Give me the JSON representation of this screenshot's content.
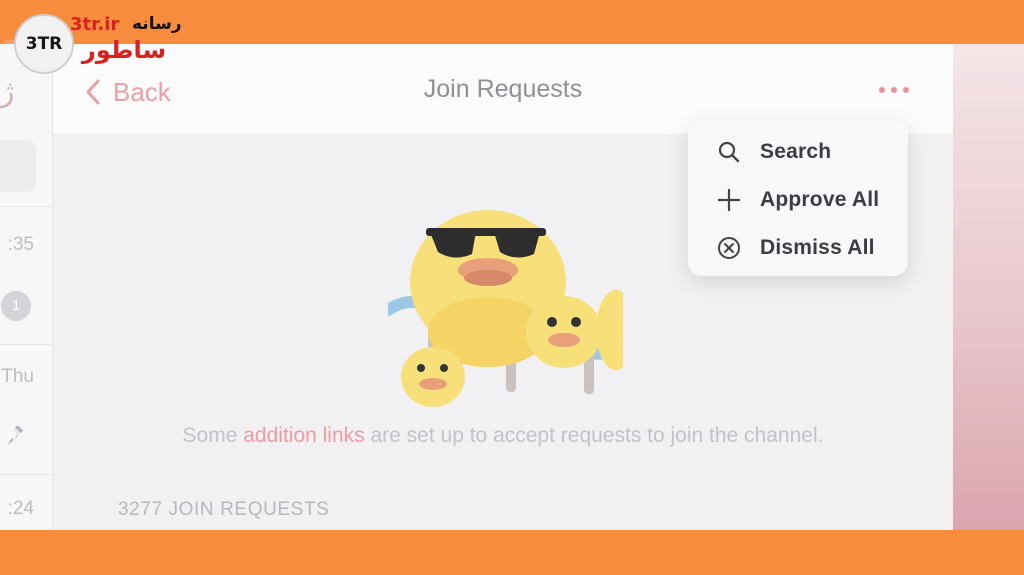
{
  "watermark": {
    "site": "3tr.ir",
    "badge": "3TR",
    "line1": "رسانه",
    "line2": "ساطور"
  },
  "chat_list": {
    "times": [
      ":35",
      "Thu",
      ":24"
    ],
    "unread_count": "1",
    "corner_glyph": "ژ"
  },
  "header": {
    "back_label": "Back",
    "title": "Join Requests",
    "more_icon": "more-dots-icon"
  },
  "menu": {
    "items": [
      {
        "label": "Search",
        "icon": "search-icon"
      },
      {
        "label": "Approve All",
        "icon": "plus-icon"
      },
      {
        "label": "Dismiss All",
        "icon": "circle-x-icon"
      }
    ]
  },
  "empty_state": {
    "caption_pre": "Some ",
    "caption_link": "addition links",
    "caption_post": " are set up to accept requests to join the channel.",
    "count_label": "3277 JOIN REQUESTS"
  },
  "colors": {
    "accent": "#ef8f9a",
    "frame": "#f78c3f"
  }
}
